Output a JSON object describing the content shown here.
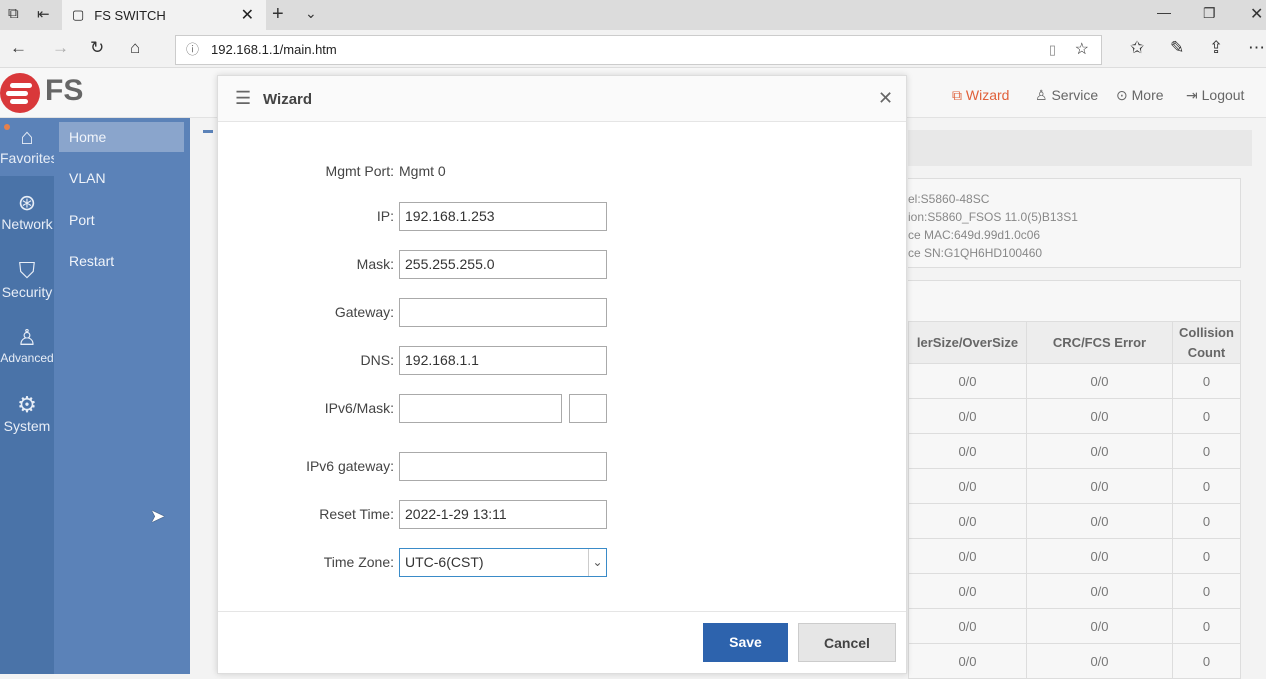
{
  "browser": {
    "tab_title": "FS SWITCH",
    "url": "192.168.1.1/main.htm"
  },
  "header": {
    "logo": "FS",
    "links": [
      {
        "label": "Wizard",
        "icon": "wizard-icon"
      },
      {
        "label": "Service",
        "icon": "headset-icon"
      },
      {
        "label": "More",
        "icon": "more-icon"
      },
      {
        "label": "Logout",
        "icon": "logout-icon"
      }
    ],
    "accent": "#e0603a"
  },
  "rail": [
    {
      "label": "Favorites",
      "icon": "home-icon"
    },
    {
      "label": "Network",
      "icon": "globe-icon"
    },
    {
      "label": "Security",
      "icon": "shield-icon"
    },
    {
      "label": "Advanced",
      "icon": "user-gear-icon"
    },
    {
      "label": "System",
      "icon": "gear-icon"
    }
  ],
  "submenu": [
    "Home",
    "VLAN",
    "Port",
    "Restart"
  ],
  "info": [
    "el:S5860-48SC",
    "ion:S5860_FSOS 11.0(5)B13S1",
    "ce MAC:649d.99d1.0c06",
    "ce SN:G1QH6HD100460"
  ],
  "table": {
    "headers": [
      "lerSize/OverSize",
      "CRC/FCS Error",
      "Collision Count"
    ],
    "rows": [
      [
        "0/0",
        "0/0",
        "0"
      ],
      [
        "0/0",
        "0/0",
        "0"
      ],
      [
        "0/0",
        "0/0",
        "0"
      ],
      [
        "0/0",
        "0/0",
        "0"
      ],
      [
        "0/0",
        "0/0",
        "0"
      ],
      [
        "0/0",
        "0/0",
        "0"
      ],
      [
        "0/0",
        "0/0",
        "0"
      ],
      [
        "0/0",
        "0/0",
        "0"
      ],
      [
        "0/0",
        "0/0",
        "0"
      ]
    ]
  },
  "wizard": {
    "title": "Wizard",
    "mgmt_label": "Mgmt Port:",
    "mgmt_value": "Mgmt 0",
    "ip_label": "IP:",
    "ip": "192.168.1.253",
    "mask_label": "Mask:",
    "mask": "255.255.255.0",
    "gateway_label": "Gateway:",
    "gateway": "",
    "dns_label": "DNS:",
    "dns": "192.168.1.1",
    "ipv6_label": "IPv6/Mask:",
    "ipv6": "",
    "ipv6_mask": "",
    "ipv6gw_label": "IPv6 gateway:",
    "ipv6gw": "",
    "reset_label": "Reset Time:",
    "reset": "2022-1-29 13:11",
    "tz_label": "Time Zone:",
    "tz": "UTC-6(CST)",
    "save": "Save",
    "cancel": "Cancel"
  }
}
